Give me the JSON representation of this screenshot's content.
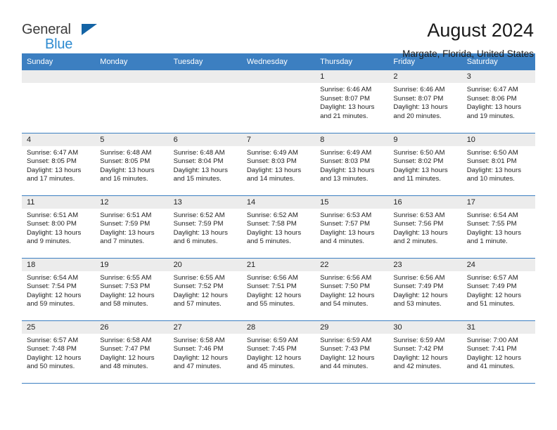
{
  "brand": {
    "name_line1": "General",
    "name_line2": "Blue",
    "accent_color": "#2E8BD0",
    "triangle_color": "#1464A5"
  },
  "header": {
    "title": "August 2024",
    "subtitle": "Margate, Florida, United States"
  },
  "theme": {
    "header_row_bg": "#3C7FC1",
    "daynum_band_bg": "#ECECEC",
    "row_divider": "#3C7FC1",
    "text": "#222222"
  },
  "weekdays": [
    "Sunday",
    "Monday",
    "Tuesday",
    "Wednesday",
    "Thursday",
    "Friday",
    "Saturday"
  ],
  "labels": {
    "sunrise_prefix": "Sunrise:",
    "sunset_prefix": "Sunset:",
    "daylight_prefix": "Daylight:"
  },
  "weeks": [
    [
      {
        "day": "",
        "empty": true
      },
      {
        "day": "",
        "empty": true
      },
      {
        "day": "",
        "empty": true
      },
      {
        "day": "",
        "empty": true
      },
      {
        "day": "1",
        "sunrise": "Sunrise: 6:46 AM",
        "sunset": "Sunset: 8:07 PM",
        "daylight_line1": "Daylight: 13 hours",
        "daylight_line2": "and 21 minutes."
      },
      {
        "day": "2",
        "sunrise": "Sunrise: 6:46 AM",
        "sunset": "Sunset: 8:07 PM",
        "daylight_line1": "Daylight: 13 hours",
        "daylight_line2": "and 20 minutes."
      },
      {
        "day": "3",
        "sunrise": "Sunrise: 6:47 AM",
        "sunset": "Sunset: 8:06 PM",
        "daylight_line1": "Daylight: 13 hours",
        "daylight_line2": "and 19 minutes."
      }
    ],
    [
      {
        "day": "4",
        "sunrise": "Sunrise: 6:47 AM",
        "sunset": "Sunset: 8:05 PM",
        "daylight_line1": "Daylight: 13 hours",
        "daylight_line2": "and 17 minutes."
      },
      {
        "day": "5",
        "sunrise": "Sunrise: 6:48 AM",
        "sunset": "Sunset: 8:05 PM",
        "daylight_line1": "Daylight: 13 hours",
        "daylight_line2": "and 16 minutes."
      },
      {
        "day": "6",
        "sunrise": "Sunrise: 6:48 AM",
        "sunset": "Sunset: 8:04 PM",
        "daylight_line1": "Daylight: 13 hours",
        "daylight_line2": "and 15 minutes."
      },
      {
        "day": "7",
        "sunrise": "Sunrise: 6:49 AM",
        "sunset": "Sunset: 8:03 PM",
        "daylight_line1": "Daylight: 13 hours",
        "daylight_line2": "and 14 minutes."
      },
      {
        "day": "8",
        "sunrise": "Sunrise: 6:49 AM",
        "sunset": "Sunset: 8:03 PM",
        "daylight_line1": "Daylight: 13 hours",
        "daylight_line2": "and 13 minutes."
      },
      {
        "day": "9",
        "sunrise": "Sunrise: 6:50 AM",
        "sunset": "Sunset: 8:02 PM",
        "daylight_line1": "Daylight: 13 hours",
        "daylight_line2": "and 11 minutes."
      },
      {
        "day": "10",
        "sunrise": "Sunrise: 6:50 AM",
        "sunset": "Sunset: 8:01 PM",
        "daylight_line1": "Daylight: 13 hours",
        "daylight_line2": "and 10 minutes."
      }
    ],
    [
      {
        "day": "11",
        "sunrise": "Sunrise: 6:51 AM",
        "sunset": "Sunset: 8:00 PM",
        "daylight_line1": "Daylight: 13 hours",
        "daylight_line2": "and 9 minutes."
      },
      {
        "day": "12",
        "sunrise": "Sunrise: 6:51 AM",
        "sunset": "Sunset: 7:59 PM",
        "daylight_line1": "Daylight: 13 hours",
        "daylight_line2": "and 7 minutes."
      },
      {
        "day": "13",
        "sunrise": "Sunrise: 6:52 AM",
        "sunset": "Sunset: 7:59 PM",
        "daylight_line1": "Daylight: 13 hours",
        "daylight_line2": "and 6 minutes."
      },
      {
        "day": "14",
        "sunrise": "Sunrise: 6:52 AM",
        "sunset": "Sunset: 7:58 PM",
        "daylight_line1": "Daylight: 13 hours",
        "daylight_line2": "and 5 minutes."
      },
      {
        "day": "15",
        "sunrise": "Sunrise: 6:53 AM",
        "sunset": "Sunset: 7:57 PM",
        "daylight_line1": "Daylight: 13 hours",
        "daylight_line2": "and 4 minutes."
      },
      {
        "day": "16",
        "sunrise": "Sunrise: 6:53 AM",
        "sunset": "Sunset: 7:56 PM",
        "daylight_line1": "Daylight: 13 hours",
        "daylight_line2": "and 2 minutes."
      },
      {
        "day": "17",
        "sunrise": "Sunrise: 6:54 AM",
        "sunset": "Sunset: 7:55 PM",
        "daylight_line1": "Daylight: 13 hours",
        "daylight_line2": "and 1 minute."
      }
    ],
    [
      {
        "day": "18",
        "sunrise": "Sunrise: 6:54 AM",
        "sunset": "Sunset: 7:54 PM",
        "daylight_line1": "Daylight: 12 hours",
        "daylight_line2": "and 59 minutes."
      },
      {
        "day": "19",
        "sunrise": "Sunrise: 6:55 AM",
        "sunset": "Sunset: 7:53 PM",
        "daylight_line1": "Daylight: 12 hours",
        "daylight_line2": "and 58 minutes."
      },
      {
        "day": "20",
        "sunrise": "Sunrise: 6:55 AM",
        "sunset": "Sunset: 7:52 PM",
        "daylight_line1": "Daylight: 12 hours",
        "daylight_line2": "and 57 minutes."
      },
      {
        "day": "21",
        "sunrise": "Sunrise: 6:56 AM",
        "sunset": "Sunset: 7:51 PM",
        "daylight_line1": "Daylight: 12 hours",
        "daylight_line2": "and 55 minutes."
      },
      {
        "day": "22",
        "sunrise": "Sunrise: 6:56 AM",
        "sunset": "Sunset: 7:50 PM",
        "daylight_line1": "Daylight: 12 hours",
        "daylight_line2": "and 54 minutes."
      },
      {
        "day": "23",
        "sunrise": "Sunrise: 6:56 AM",
        "sunset": "Sunset: 7:49 PM",
        "daylight_line1": "Daylight: 12 hours",
        "daylight_line2": "and 53 minutes."
      },
      {
        "day": "24",
        "sunrise": "Sunrise: 6:57 AM",
        "sunset": "Sunset: 7:49 PM",
        "daylight_line1": "Daylight: 12 hours",
        "daylight_line2": "and 51 minutes."
      }
    ],
    [
      {
        "day": "25",
        "sunrise": "Sunrise: 6:57 AM",
        "sunset": "Sunset: 7:48 PM",
        "daylight_line1": "Daylight: 12 hours",
        "daylight_line2": "and 50 minutes."
      },
      {
        "day": "26",
        "sunrise": "Sunrise: 6:58 AM",
        "sunset": "Sunset: 7:47 PM",
        "daylight_line1": "Daylight: 12 hours",
        "daylight_line2": "and 48 minutes."
      },
      {
        "day": "27",
        "sunrise": "Sunrise: 6:58 AM",
        "sunset": "Sunset: 7:46 PM",
        "daylight_line1": "Daylight: 12 hours",
        "daylight_line2": "and 47 minutes."
      },
      {
        "day": "28",
        "sunrise": "Sunrise: 6:59 AM",
        "sunset": "Sunset: 7:45 PM",
        "daylight_line1": "Daylight: 12 hours",
        "daylight_line2": "and 45 minutes."
      },
      {
        "day": "29",
        "sunrise": "Sunrise: 6:59 AM",
        "sunset": "Sunset: 7:43 PM",
        "daylight_line1": "Daylight: 12 hours",
        "daylight_line2": "and 44 minutes."
      },
      {
        "day": "30",
        "sunrise": "Sunrise: 6:59 AM",
        "sunset": "Sunset: 7:42 PM",
        "daylight_line1": "Daylight: 12 hours",
        "daylight_line2": "and 42 minutes."
      },
      {
        "day": "31",
        "sunrise": "Sunrise: 7:00 AM",
        "sunset": "Sunset: 7:41 PM",
        "daylight_line1": "Daylight: 12 hours",
        "daylight_line2": "and 41 minutes."
      }
    ]
  ]
}
